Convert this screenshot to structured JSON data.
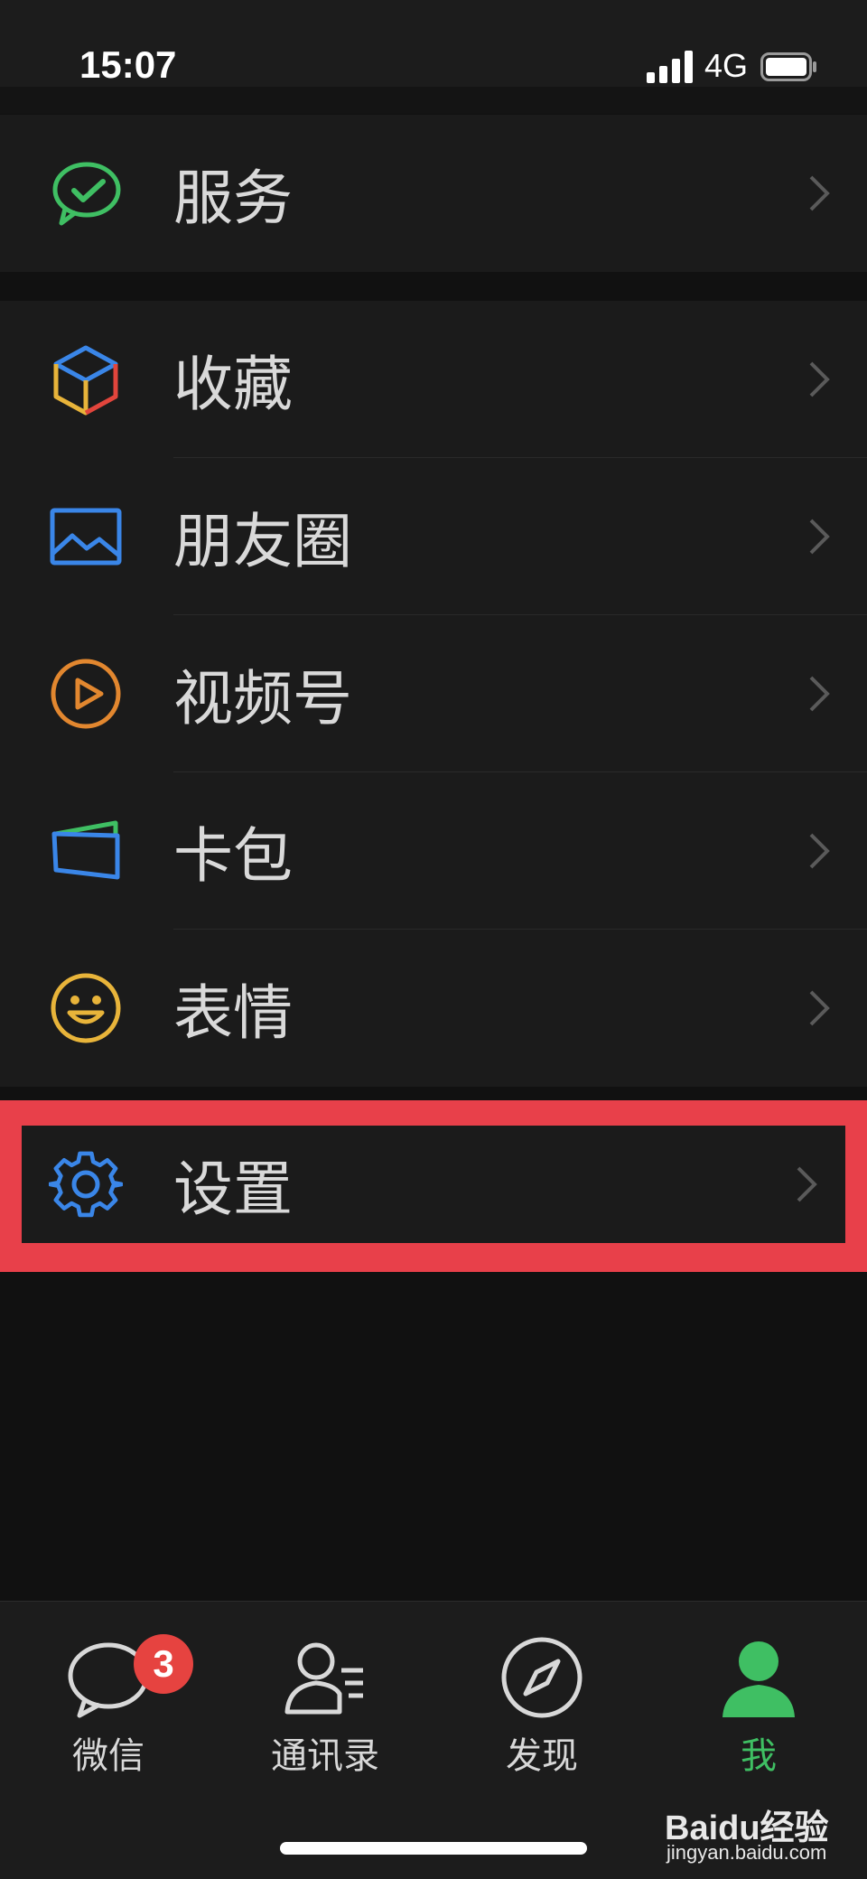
{
  "status_bar": {
    "time": "15:07",
    "network": "4G"
  },
  "groups": [
    {
      "items": [
        {
          "label": "服务",
          "icon": "wechat-pay-check-icon"
        }
      ]
    },
    {
      "items": [
        {
          "label": "收藏",
          "icon": "cube-icon"
        },
        {
          "label": "朋友圈",
          "icon": "photo-icon"
        },
        {
          "label": "视频号",
          "icon": "play-circle-icon"
        },
        {
          "label": "卡包",
          "icon": "card-wallet-icon"
        },
        {
          "label": "表情",
          "icon": "smiley-icon"
        }
      ]
    },
    {
      "items": [
        {
          "label": "设置",
          "icon": "gear-icon"
        }
      ]
    }
  ],
  "tabbar": {
    "tabs": [
      {
        "label": "微信",
        "icon": "chat-bubble-icon",
        "badge": "3"
      },
      {
        "label": "通讯录",
        "icon": "contacts-icon"
      },
      {
        "label": "发现",
        "icon": "compass-icon"
      },
      {
        "label": "我",
        "icon": "person-icon",
        "active": true
      }
    ]
  },
  "watermark": {
    "brand": "Baidu经验",
    "url": "jingyan.baidu.com"
  },
  "colors": {
    "accent_green": "#3fbf63",
    "highlight_red": "#e8404a",
    "badge_red": "#e64340"
  }
}
